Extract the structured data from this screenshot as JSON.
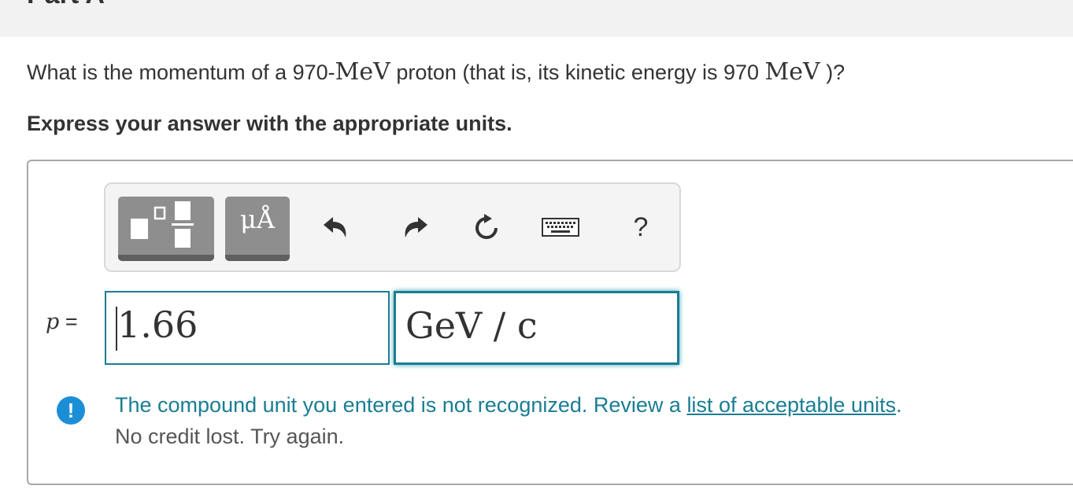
{
  "part": {
    "title": "Part A"
  },
  "question": {
    "text_before": "What is the momentum of a 970-",
    "unit_inline": "MeV",
    "text_middle": " proton (that is, its kinetic energy is 970 ",
    "unit_inline2": "MeV",
    "text_after": " )?"
  },
  "instruction": "Express your answer with the appropriate units.",
  "toolbar": {
    "units_label": "μÅ",
    "help_label": "?",
    "icons": [
      "templates-icon",
      "units-icon",
      "undo-icon",
      "redo-icon",
      "reset-icon",
      "keyboard-icon",
      "help-icon"
    ]
  },
  "answer": {
    "variable": "p",
    "equals": "=",
    "value": "1.66",
    "unit": "GeV / c"
  },
  "feedback": {
    "message": "The compound unit you entered is not recognized. Review a ",
    "link_text": "list of acceptable units",
    "message_end": ".",
    "secondary": "No credit lost. Try again.",
    "alert_symbol": "!"
  },
  "colors": {
    "accent": "#1a7d92",
    "alert": "#1b8fd6",
    "toolbar_button": "#8e8e8e"
  }
}
